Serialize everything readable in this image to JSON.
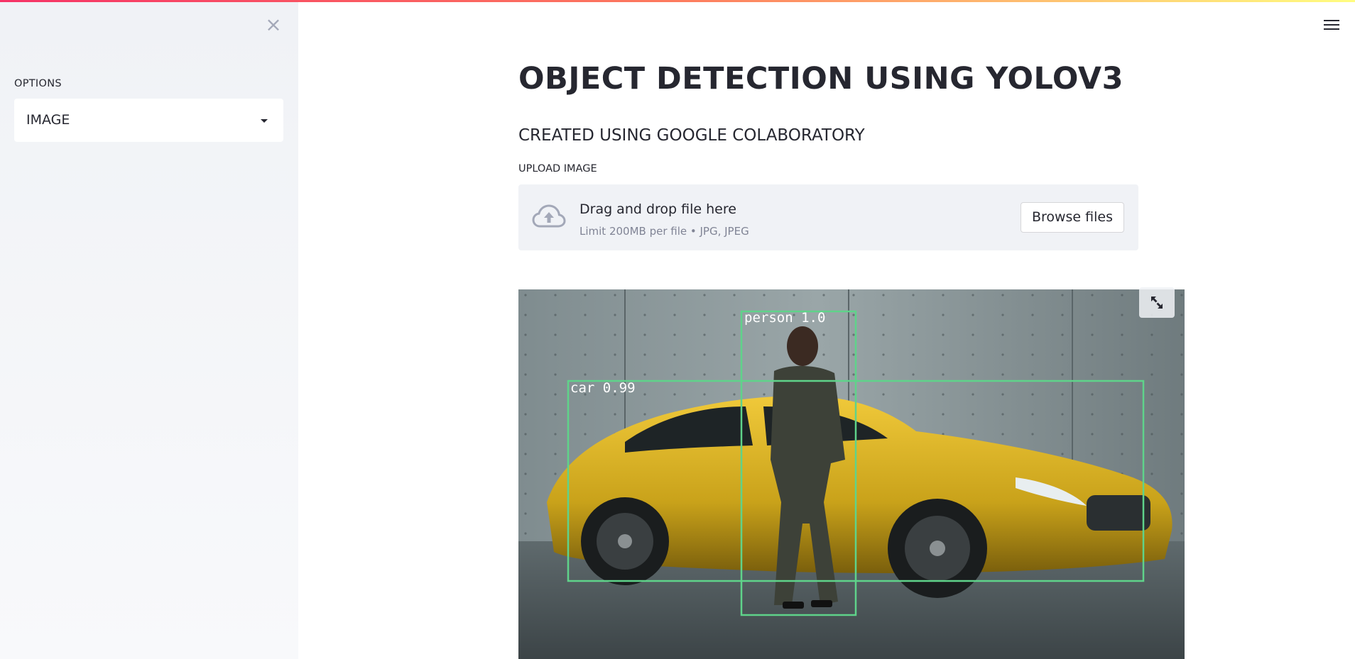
{
  "sidebar": {
    "close_glyph": "×",
    "options_label": "OPTIONS",
    "select_value": "IMAGE"
  },
  "main": {
    "title": "OBJECT DETECTION USING YOLOV3",
    "subtitle": "CREATED USING GOOGLE COLABORATORY",
    "upload_label": "UPLOAD IMAGE",
    "dropzone_text": "Drag and drop file here",
    "dropzone_limit": "Limit 200MB per file • JPG, JPEG",
    "browse_button": "Browse files"
  },
  "detections": [
    {
      "label": "person 1.0"
    },
    {
      "label": "car 0.99"
    }
  ],
  "colors": {
    "accent_gradient_start": "#f63366",
    "accent_gradient_end": "#fffd80",
    "sidebar_bg": "#f0f2f6",
    "box_color": "#5fd38a",
    "car_yellow": "#c9a21a"
  },
  "icons": {
    "close": "close-icon",
    "menu": "hamburger-menu-icon",
    "upload": "cloud-upload-icon",
    "expand": "expand-icon",
    "dropdown": "caret-down-icon"
  }
}
